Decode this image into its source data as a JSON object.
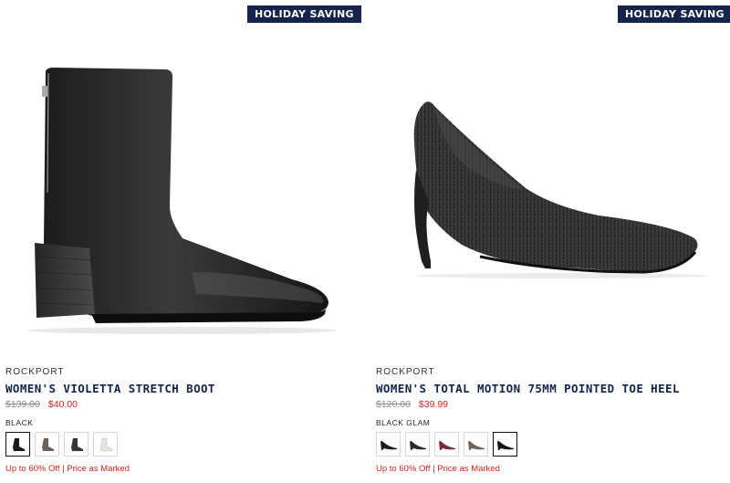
{
  "products": [
    {
      "badge": "HOLIDAY SAVING",
      "brand": "ROCKPORT",
      "title": "WOMEN'S VIOLETTA STRETCH BOOT",
      "price_original": "$139.00",
      "price_sale": "$40.00",
      "selected_color": "BLACK",
      "swatches": [
        "black",
        "taupe",
        "dark-brown",
        "white"
      ],
      "promo": "Up to 60% Off | Price as Marked"
    },
    {
      "badge": "HOLIDAY SAVING",
      "brand": "ROCKPORT",
      "title": "WOMEN'S TOTAL MOTION 75MM POINTED TOE HEEL",
      "price_original": "$120.00",
      "price_sale": "$39.99",
      "selected_color": "BLACK GLAM",
      "swatches": [
        "black",
        "black-leather",
        "burgundy",
        "taupe",
        "black-glam"
      ],
      "promo": "Up to 60% Off | Price as Marked"
    }
  ],
  "colors": {
    "badge_bg": "#14244a",
    "title": "#14244a",
    "sale": "#d6231f"
  }
}
